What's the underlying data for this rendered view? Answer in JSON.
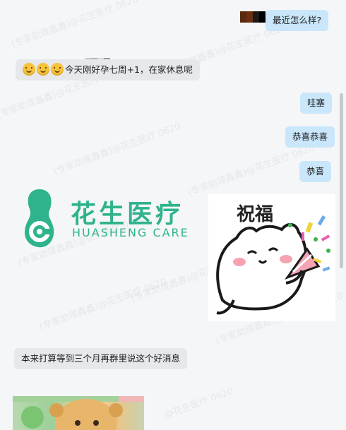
{
  "watermark": {
    "text": "@花生医疗 0620",
    "text_alt": "(专家助理鑫鑫)@花生医疗 0620"
  },
  "messages": [
    {
      "id": "m1",
      "side": "out",
      "text": "最近怎么样?"
    },
    {
      "id": "m2",
      "side": "in",
      "emoji_count": 3,
      "text": "今天刚好孕七周+1，在家休息呢"
    },
    {
      "id": "m3",
      "side": "out",
      "text": "哇塞"
    },
    {
      "id": "m4",
      "side": "out",
      "text": "恭喜恭喜"
    },
    {
      "id": "m5",
      "side": "out",
      "text": "恭喜"
    },
    {
      "id": "m6",
      "side": "in",
      "text": "本来打算等到三个月再群里说这个好消息"
    }
  ],
  "logo": {
    "cn": "花生医疗",
    "en": "HUASHENG CARE",
    "color": "#2fb38d"
  },
  "sticker": {
    "title": "祝福"
  },
  "colors": {
    "bubble_out": "#c9e6fb",
    "bubble_in": "#e6e8ec",
    "background": "#f5f6f8"
  }
}
